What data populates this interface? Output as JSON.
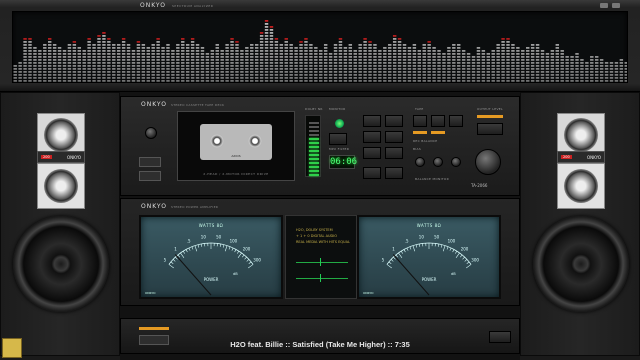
{
  "analyzer": {
    "brand": "ONKYO",
    "sub": "SPECTRUM ANALYZER",
    "bars": [
      18,
      20,
      46,
      44,
      36,
      34,
      38,
      46,
      40,
      36,
      34,
      38,
      42,
      36,
      34,
      44,
      40,
      48,
      52,
      46,
      40,
      38,
      44,
      40,
      34,
      42,
      38,
      36,
      40,
      44,
      36,
      38,
      34,
      40,
      46,
      38,
      44,
      40,
      36,
      30,
      34,
      38,
      32,
      40,
      44,
      42,
      34,
      36,
      38,
      40,
      52,
      62,
      58,
      46,
      40,
      44,
      38,
      36,
      42,
      46,
      40,
      36,
      34,
      38,
      30,
      40,
      44,
      36,
      38,
      34,
      40,
      46,
      42,
      38,
      34,
      36,
      40,
      48,
      44,
      38,
      36,
      40,
      34,
      38,
      42,
      36,
      34,
      30,
      36,
      40,
      38,
      34,
      30,
      28,
      36,
      32,
      30,
      34,
      40,
      46,
      44,
      38,
      36,
      32,
      36,
      40,
      38,
      34,
      30,
      34,
      38,
      32,
      28,
      26,
      30,
      24,
      22,
      26,
      28,
      24,
      22,
      20,
      22,
      24,
      20
    ]
  },
  "deck": {
    "brand": "ONKYO",
    "sub": "STEREO CASSETTE TAPE DECK",
    "tape_label": "AXIOS",
    "tape_caption": "2-HEAD / 2-MOTOR DIRECT DRIVE",
    "counter": "06:06",
    "model": "TA-2066",
    "labels": {
      "dolby": "DOLBY NR",
      "monitor": "MONITOR",
      "mpx": "MPX FILTER",
      "tape": "TAPE",
      "rec_balance": "REC BALANCE",
      "bias": "BIAS",
      "output": "OUTPUT LEVEL",
      "balance": "BALANCE MONITOR"
    }
  },
  "amp": {
    "brand": "ONKYO",
    "sub": "STEREO POWER AMPLIFIER",
    "left_title": "WATTS 8Ω",
    "right_title": "WATTS 8Ω",
    "power": "POWER",
    "db": "dB",
    "meter_brand": "ONKYO",
    "scale": [
      "5",
      "1",
      ".5",
      "10",
      "50",
      "100",
      "200",
      "300"
    ],
    "info": [
      "H2O, DOLBY SYSTEM",
      "+ 1 + 0 DIGITAL AUDIO",
      "REAL MEDIA WITH HITS EQUAL"
    ]
  },
  "speakers": {
    "label": "ONKYO",
    "badge": "200"
  },
  "now_playing": "H2O feat. Billie :: Satisfied (Take Me Higher) :: 7:35",
  "colors": {
    "spectrum": "#c9c9c9",
    "peak": "#d62020",
    "vu": "#2fd14a",
    "accent": "#e59a23"
  }
}
